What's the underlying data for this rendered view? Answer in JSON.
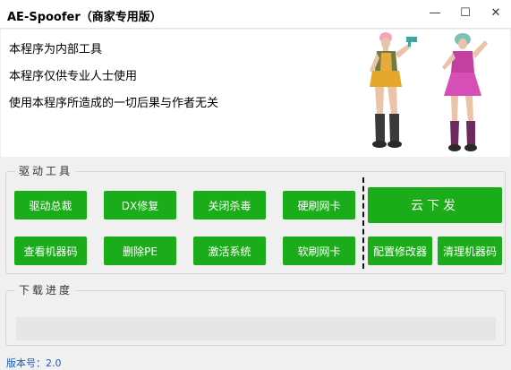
{
  "window": {
    "title": "AE-Spoofer（商家专用版）",
    "minimize_glyph": "—",
    "maximize_glyph": "☐",
    "close_glyph": "✕"
  },
  "banner": {
    "notices": [
      "本程序为内部工具",
      "本程序仅供专业人士使用",
      "使用本程序所造成的一切后果与作者无关"
    ]
  },
  "driver_tools": {
    "legend": "驱动工具",
    "buttons": [
      "驱动总裁",
      "DX修复",
      "关闭杀毒",
      "硬刷网卡",
      "查看机器码",
      "删除PE",
      "激活系统",
      "软刷网卡"
    ],
    "cloud_button": "云下发",
    "config_button": "配置修改器",
    "clean_button": "清理机器码"
  },
  "download": {
    "legend": "下载进度",
    "progress": 0
  },
  "footer": {
    "version": "版本号：2.0"
  },
  "colors": {
    "button_green": "#1aad19",
    "version_blue": "#1f5bb8"
  }
}
